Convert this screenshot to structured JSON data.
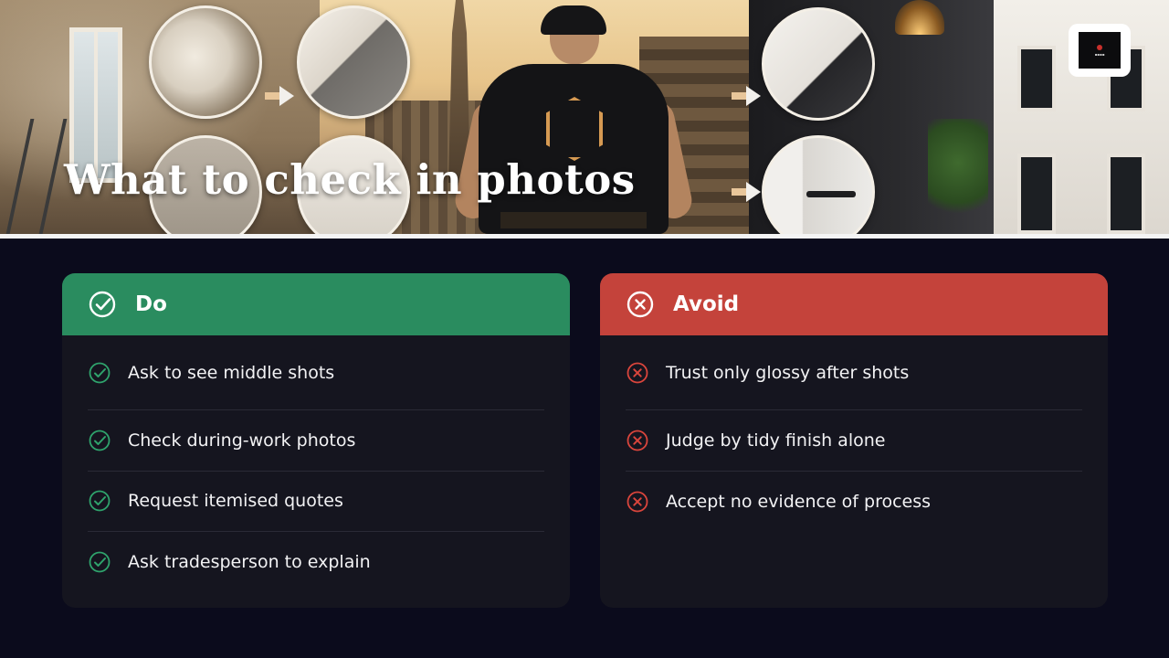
{
  "hero": {
    "title": "What to check in photos"
  },
  "colors": {
    "background": "#0b0b1c",
    "card_bg": "#15151f",
    "do_accent": "#2a8c5f",
    "avoid_accent": "#c4433b",
    "text": "#f2f2f4"
  },
  "do_card": {
    "title": "Do",
    "icon": "check-circle-icon",
    "items": [
      {
        "label": "Ask to see middle shots",
        "icon": "check-circle-icon"
      },
      {
        "label": "Check during-work photos",
        "icon": "check-circle-icon"
      },
      {
        "label": "Request itemised quotes",
        "icon": "check-circle-icon"
      },
      {
        "label": "Ask tradesperson to explain",
        "icon": "check-circle-icon"
      }
    ]
  },
  "avoid_card": {
    "title": "Avoid",
    "icon": "x-circle-icon",
    "items": [
      {
        "label": "Trust only glossy after shots",
        "icon": "x-circle-icon"
      },
      {
        "label": "Judge by tidy finish alone",
        "icon": "x-circle-icon"
      },
      {
        "label": "Accept no evidence of process",
        "icon": "x-circle-icon"
      }
    ]
  }
}
